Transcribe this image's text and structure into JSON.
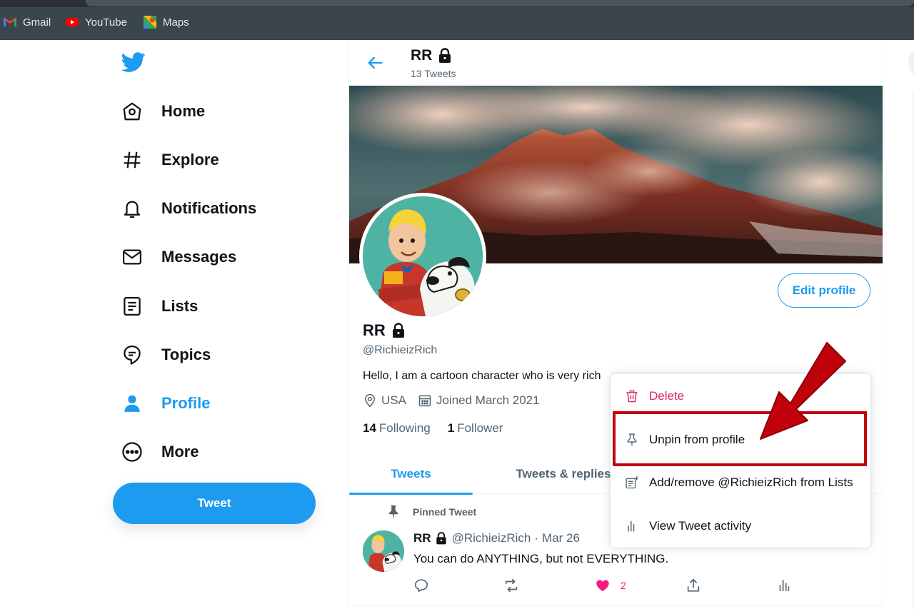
{
  "browser": {
    "bookmarks": [
      {
        "label": "Gmail",
        "icon": "gmail-icon"
      },
      {
        "label": "YouTube",
        "icon": "youtube-icon"
      },
      {
        "label": "Maps",
        "icon": "maps-icon"
      }
    ]
  },
  "nav": {
    "items": [
      {
        "label": "Home",
        "icon": "home-icon"
      },
      {
        "label": "Explore",
        "icon": "hashtag-icon"
      },
      {
        "label": "Notifications",
        "icon": "bell-icon"
      },
      {
        "label": "Messages",
        "icon": "envelope-icon"
      },
      {
        "label": "Lists",
        "icon": "list-icon"
      },
      {
        "label": "Topics",
        "icon": "topics-icon"
      },
      {
        "label": "Profile",
        "icon": "person-icon"
      },
      {
        "label": "More",
        "icon": "more-circle-icon"
      }
    ],
    "active": "Profile",
    "tweet_button": "Tweet"
  },
  "header": {
    "name": "RR",
    "tweet_count": "13 Tweets"
  },
  "profile": {
    "name": "RR",
    "handle": "@RichieizRich",
    "bio": "Hello, I am a cartoon character who is very rich",
    "location": "USA",
    "joined": "Joined March 2021",
    "following_count": "14",
    "following_label": "Following",
    "followers_count": "1",
    "followers_label": "Follower",
    "edit_button": "Edit profile"
  },
  "tabs": [
    {
      "label": "Tweets",
      "active": true
    },
    {
      "label": "Tweets & replies",
      "active": false
    }
  ],
  "tweet": {
    "pinned_label": "Pinned Tweet",
    "name": "RR",
    "handle": "@RichieizRich",
    "separator": "·",
    "date": "Mar 26",
    "text": "You can do ANYTHING, but not EVERYTHING.",
    "likes": "2"
  },
  "menu": {
    "items": [
      {
        "label": "Delete",
        "icon": "trash-icon",
        "danger": true
      },
      {
        "label": "Unpin from profile",
        "icon": "pin-icon",
        "danger": false
      },
      {
        "label": "Add/remove @RichieizRich from Lists",
        "icon": "list-add-icon",
        "danger": false
      },
      {
        "label": "View Tweet activity",
        "icon": "bar-chart-icon",
        "danger": false
      }
    ]
  },
  "colors": {
    "accent": "#1d9bf0",
    "danger": "#d7266c",
    "annotation": "#c0000b",
    "like": "#f91880"
  }
}
